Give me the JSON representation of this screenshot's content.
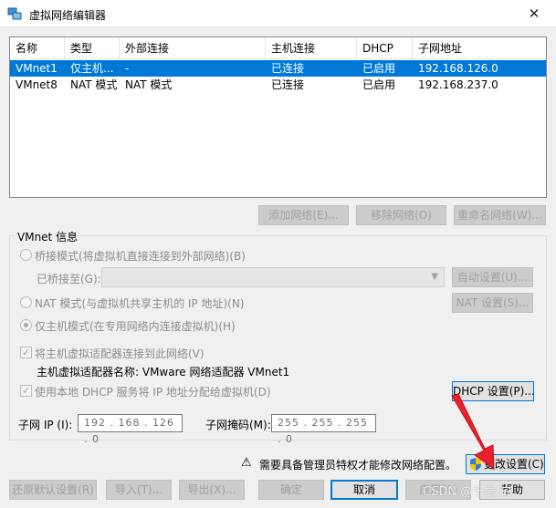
{
  "window": {
    "title": "虚拟网络编辑器",
    "close_glyph": "✕"
  },
  "table": {
    "columns": [
      "名称",
      "类型",
      "外部连接",
      "主机连接",
      "DHCP",
      "子网地址"
    ],
    "rows": [
      {
        "name": "VMnet1",
        "type": "仅主机...",
        "external": "-",
        "host": "已连接",
        "dhcp": "已启用",
        "subnet": "192.168.126.0",
        "selected": true
      },
      {
        "name": "VMnet8",
        "type": "NAT 模式",
        "external": "NAT 模式",
        "host": "已连接",
        "dhcp": "已启用",
        "subnet": "192.168.237.0",
        "selected": false
      }
    ]
  },
  "list_buttons": {
    "add": "添加网络(E)...",
    "remove": "移除网络(O)",
    "rename": "重命名网络(W)..."
  },
  "vmnet_info": {
    "legend": "VMnet 信息",
    "bridged_label": "桥接模式(将虚拟机直接连接到外部网络)(B)",
    "bridged_to_label": "已桥接至(G):",
    "auto_settings": "自动设置(U)...",
    "nat_label": "NAT 模式(与虚拟机共享主机的 IP 地址)(N)",
    "nat_settings": "NAT 设置(S)...",
    "hostonly_label": "仅主机模式(在专用网络内连接虚拟机)(H)",
    "connect_adapter_label": "将主机虚拟适配器连接到此网络(V)",
    "adapter_name_label": "主机虚拟适配器名称: VMware 网络适配器 VMnet1",
    "use_dhcp_label": "使用本地 DHCP 服务将 IP 地址分配给虚拟机(D)",
    "dhcp_settings": "DHCP 设置(P)...",
    "subnet_ip_label": "子网 IP (I):",
    "subnet_ip_value": "192 . 168 . 126 .  0",
    "subnet_mask_label": "子网掩码(M):",
    "subnet_mask_value": "255 . 255 . 255 .  0"
  },
  "admin": {
    "warning_glyph": "⚠",
    "notice": "需要具备管理员特权才能修改网络配置。",
    "change_settings": "更改设置(C)"
  },
  "footer": {
    "restore_defaults": "还原默认设置(R)",
    "import": "导入(T)...",
    "export": "导出(X)...",
    "ok": "确定",
    "cancel": "取消",
    "apply": "应用(A)",
    "help": "帮助"
  },
  "watermark": "CSDN @千层!白",
  "colors": {
    "selection": "#0078d7",
    "annotation_arrow": "#e8212b"
  }
}
